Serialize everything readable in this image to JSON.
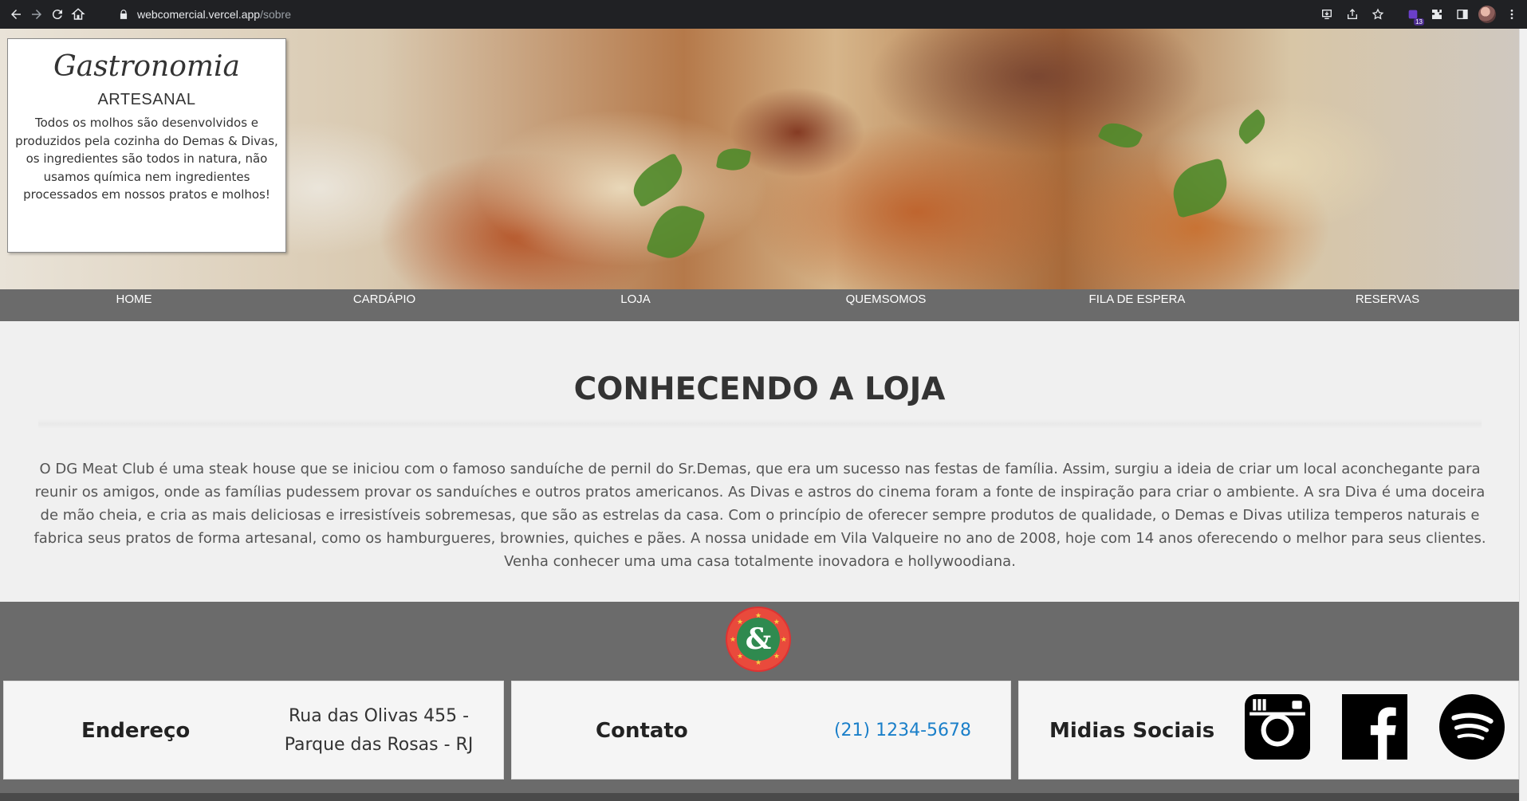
{
  "browser": {
    "url_host": "webcomercial.vercel.app",
    "url_path": "/sobre",
    "extension_badge": "13"
  },
  "intro": {
    "title": "Gastronomia",
    "subtitle": "ARTESANAL",
    "text": "Todos os molhos são desenvolvidos e produzidos pela cozinha do Demas & Divas, os ingredientes são todos in natura, não usamos química nem ingredientes processados em nossos pratos e molhos!"
  },
  "menu": {
    "items": [
      "HOME",
      "CARDÁPIO",
      "LOJA",
      "QUEMSOMOS",
      "FILA DE ESPERA",
      "RESERVAS"
    ]
  },
  "about": {
    "title": "CONHECENDO A LOJA",
    "text": "O DG Meat Club é uma steak house que se iniciou com o famoso sanduíche de pernil do Sr.Demas, que era um sucesso nas festas de família. Assim, surgiu a ideia de criar um local aconchegante para reunir os amigos, onde as famílias pudessem provar os sanduíches e outros pratos americanos. As Divas e astros do cinema foram a fonte de inspiração para criar o ambiente. A sra Diva é uma doceira de mão cheia, e cria as mais deliciosas e irresistíveis sobremesas, que são as estrelas da casa. Com o princípio de oferecer sempre produtos de qualidade, o Demas e Divas utiliza temperos naturais e fabrica seus pratos de forma artesanal, como os hamburgueres, brownies, quiches e pães. A nossa unidade em Vila Valqueire no ano de 2008, hoje com 14 anos oferecendo o melhor para seus clientes. Venha conhecer uma uma casa totalmente inovadora e hollywoodiana."
  },
  "footer": {
    "logo_glyph": "&",
    "address_label": "Endereço",
    "address_value": "Rua das Olivas 455 - Parque das Rosas - RJ",
    "contact_label": "Contato",
    "contact_value": "(21) 1234-5678",
    "social_label": "Midias Sociais",
    "social_icons": [
      "instagram-icon",
      "facebook-icon",
      "spotify-icon"
    ]
  },
  "colors": {
    "nav_bg": "#6b6b6b",
    "footer_bg": "#6b6b6b",
    "page_bg": "#f0f0f0",
    "phone_link": "#1a7fc9",
    "logo_red": "#e94a3c",
    "logo_green": "#2f8a4f"
  }
}
